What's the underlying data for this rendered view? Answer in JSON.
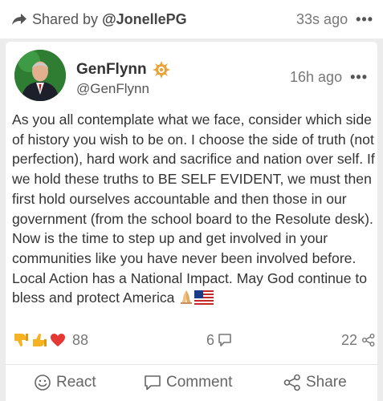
{
  "shared_bar": {
    "prefix": "Shared by",
    "user": "@JonellePG",
    "time": "33s ago",
    "menu_icon": "more-horizontal-icon"
  },
  "post": {
    "author_name": "GenFlynn",
    "author_handle": "@GenFlynn",
    "time": "16h ago",
    "body": "As you all contemplate what we face, consider which side of history you wish to be on. I choose the side of truth (not perfection), hard work and sacrifice and nation over self. If we hold these truths to BE SELF EVIDENT, we must then first hold ourselves accountable and then those in our government (from the school board to the Resolute desk). Now is the time to step up and get involved in your communities like you have never been involved before. Local Action has a National Impact. May God continue to bless and protect America",
    "body_emojis": [
      "praying-hands-emoji",
      "us-flag-emoji"
    ]
  },
  "stats": {
    "reaction_icons": [
      "thumbs-down-emoji",
      "thumbs-up-emoji",
      "heart-emoji"
    ],
    "reactions_count": "88",
    "comments_count": "6",
    "shares_count": "22"
  },
  "actions": {
    "react_label": "React",
    "comment_label": "Comment",
    "share_label": "Share"
  },
  "colors": {
    "background": "#ececec",
    "card": "#ffffff",
    "badge": "#e8a33a",
    "avatar_bg": "#2e7d32"
  }
}
